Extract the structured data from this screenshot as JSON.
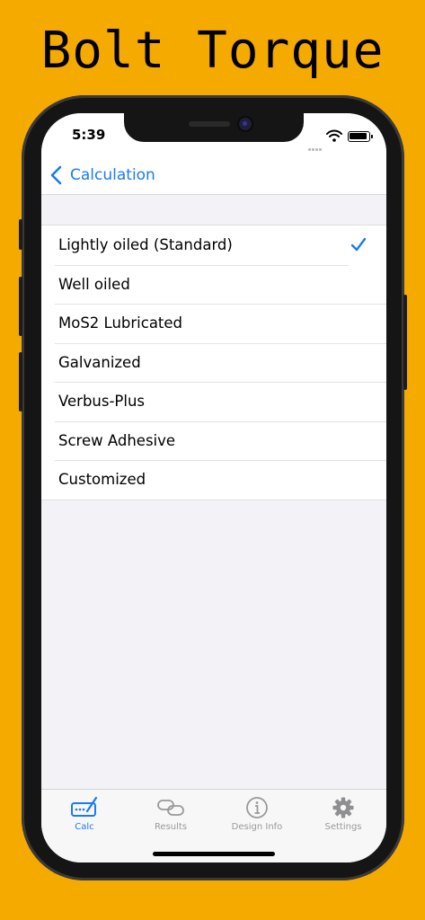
{
  "promo": {
    "title": "Bolt Torque"
  },
  "status_bar": {
    "time": "5:39"
  },
  "nav": {
    "back_label": "Calculation"
  },
  "list": {
    "items": [
      {
        "label": "Lightly oiled (Standard)",
        "selected": true
      },
      {
        "label": "Well oiled",
        "selected": false
      },
      {
        "label": "MoS2 Lubricated",
        "selected": false
      },
      {
        "label": "Galvanized",
        "selected": false
      },
      {
        "label": "Verbus-Plus",
        "selected": false
      },
      {
        "label": "Screw Adhesive",
        "selected": false
      },
      {
        "label": "Customized",
        "selected": false
      }
    ]
  },
  "tabs": [
    {
      "label": "Calc",
      "icon": "calc-icon",
      "active": true
    },
    {
      "label": "Results",
      "icon": "link-icon",
      "active": false
    },
    {
      "label": "Design Info",
      "icon": "info-icon",
      "active": false
    },
    {
      "label": "Settings",
      "icon": "gear-icon",
      "active": false
    }
  ],
  "colors": {
    "background": "#F5AA00",
    "accent": "#1A7BF2",
    "inactive": "#999999"
  }
}
